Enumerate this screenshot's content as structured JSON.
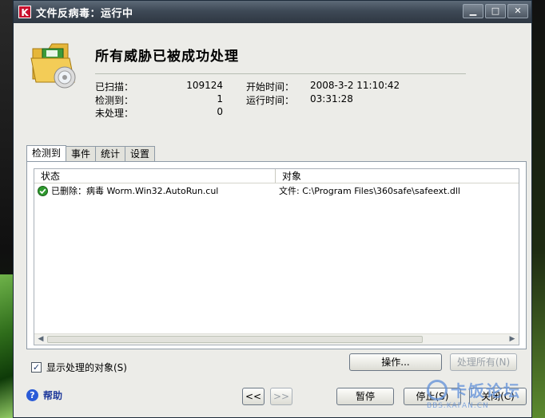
{
  "window": {
    "title": "文件反病毒：运行中",
    "logo_letter": "K",
    "buttons": {
      "min": "▁",
      "max": "□",
      "close": "✕"
    }
  },
  "summary": {
    "headline": "所有威胁已被成功处理",
    "scanned_label": "已扫描：",
    "scanned_value": "109124",
    "detected_label": "检测到：",
    "detected_value": "1",
    "unprocessed_label": "未处理：",
    "unprocessed_value": "0",
    "start_label": "开始时间：",
    "start_value": "2008-3-2 11:10:42",
    "runtime_label": "运行时间：",
    "runtime_value": "03:31:28"
  },
  "tabs": [
    "检测到",
    "事件",
    "统计",
    "设置"
  ],
  "list": {
    "columns": {
      "status": "状态",
      "target": "对象"
    },
    "rows": [
      {
        "status": "已删除：病毒 Worm.Win32.AutoRun.cul",
        "target": "文件: C:\\Program Files\\360safe\\safeext.dll"
      }
    ]
  },
  "options": {
    "show_processed_label": "显示处理的对象(S)",
    "show_processed_checked": true
  },
  "buttons": {
    "action": "操作...",
    "process_all": "处理所有(N)",
    "prev": "<<",
    "next": ">>",
    "pause": "暂停",
    "stop": "停止(S)",
    "close": "关闭(C)"
  },
  "help": {
    "label": "帮助",
    "icon": "question-icon"
  },
  "watermark": {
    "text": "卡饭论坛",
    "sub": "BBS.KAFAN.CN"
  },
  "colors": {
    "accent": "#2a5bd7",
    "ok_green": "#2e9a2e",
    "title_bar": "#3e4956",
    "logo_red": "#c8102e"
  }
}
